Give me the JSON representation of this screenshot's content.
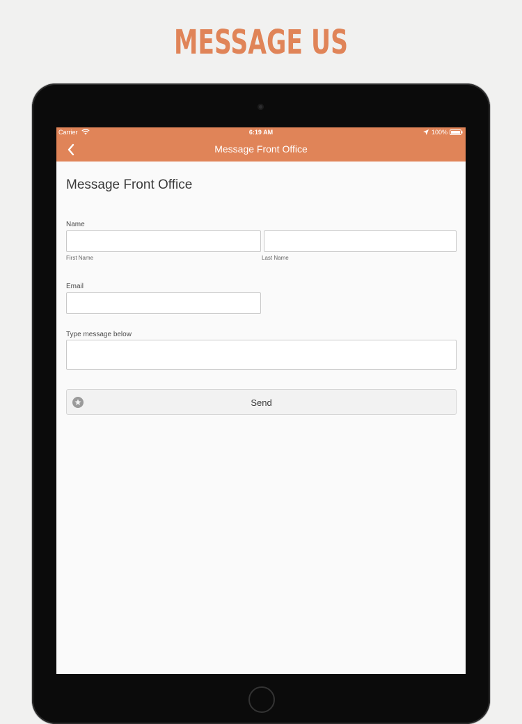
{
  "headline": "MESSAGE US",
  "status_bar": {
    "carrier": "Carrier",
    "time": "6:19 AM",
    "battery": "100%"
  },
  "navbar": {
    "title": "Message Front Office"
  },
  "form": {
    "title": "Message Front Office",
    "name_label": "Name",
    "first_name_sublabel": "First Name",
    "last_name_sublabel": "Last Name",
    "first_name_value": "",
    "last_name_value": "",
    "email_label": "Email",
    "email_value": "",
    "message_label": "Type message below",
    "message_value": "",
    "send_label": "Send"
  },
  "colors": {
    "accent": "#e08458",
    "screen_background": "#fafafa"
  },
  "icons": {
    "back": "chevron-left-icon",
    "send": "star-icon",
    "wifi": "wifi-icon",
    "location": "location-arrow-icon",
    "battery": "battery-icon"
  }
}
